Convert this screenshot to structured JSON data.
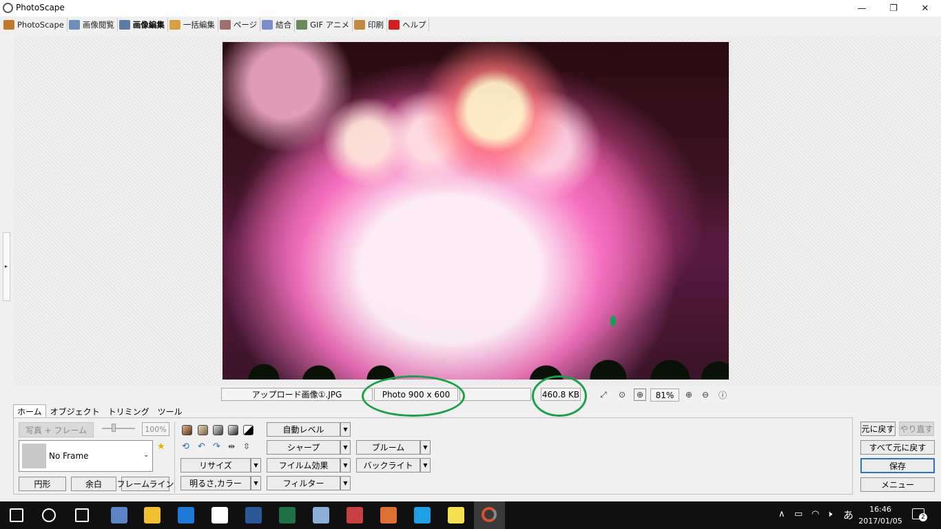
{
  "window": {
    "title": "PhotoScape",
    "controls": {
      "minimize": "—",
      "maximize": "❐",
      "close": "✕"
    }
  },
  "main_tabs": [
    {
      "label": "PhotoScape",
      "icon": "photoscape-icon",
      "color": "#c07a2a"
    },
    {
      "label": "画像閲覧",
      "icon": "viewer-icon",
      "color": "#6a8fb8"
    },
    {
      "label": "画像編集",
      "icon": "editor-icon",
      "color": "#5a7aa8",
      "active": true
    },
    {
      "label": "一括編集",
      "icon": "batch-icon",
      "color": "#d8a040"
    },
    {
      "label": "ページ",
      "icon": "page-icon",
      "color": "#a07070"
    },
    {
      "label": "結合",
      "icon": "combine-icon",
      "color": "#7a8fc8"
    },
    {
      "label": "GIF アニメ",
      "icon": "gif-icon",
      "color": "#6a8a5a"
    },
    {
      "label": "印刷",
      "icon": "print-icon",
      "color": "#c08a40"
    },
    {
      "label": "ヘルプ",
      "icon": "help-icon",
      "color": "#d02020"
    }
  ],
  "status": {
    "filename": "アップロード画像①.JPG",
    "dimensions": "Photo 900 x 600",
    "filesize": "460.8 KB",
    "zoom": "81%",
    "annotation_color": "#1aa04a"
  },
  "bottom_tabs": [
    "ホーム",
    "オブジェクト",
    "トリミング",
    "ツール"
  ],
  "home_panel": {
    "photo_frame_button": "写真 + フレーム",
    "opacity_value": "100%",
    "frame_select": "No Frame",
    "shape_buttons": [
      "円形",
      "余白",
      "フレームライン"
    ],
    "resize": "リサイズ",
    "brightness": "明るさ,カラー",
    "auto_level": "自動レベル",
    "sharpen": "シャープ",
    "film_effect": "フイルム効果",
    "filter": "フィルター",
    "bloom": "ブルーム",
    "backlight": "バックライト"
  },
  "right_actions": {
    "undo": "元に戻す",
    "redo": "やり直す",
    "undo_all": "すべて元に戻す",
    "save": "保存",
    "menu": "メニュー"
  },
  "taskbar": {
    "apps": [
      {
        "name": "windows-start-icon",
        "color": "#ffffff"
      },
      {
        "name": "cortana-icon",
        "color": "#ffffff"
      },
      {
        "name": "task-view-icon",
        "color": "#ffffff"
      },
      {
        "name": "photo-app-icon",
        "color": "#5a86c8"
      },
      {
        "name": "file-explorer-icon",
        "color": "#f0c030"
      },
      {
        "name": "edge-icon",
        "color": "#1e7ad8"
      },
      {
        "name": "store-icon",
        "color": "#ffffff"
      },
      {
        "name": "word-icon",
        "color": "#2b5797"
      },
      {
        "name": "excel-icon",
        "color": "#1e7145"
      },
      {
        "name": "paint-icon",
        "color": "#8ab0d8"
      },
      {
        "name": "tool-app-icon",
        "color": "#c84040"
      },
      {
        "name": "briefcase-icon",
        "color": "#e07030"
      },
      {
        "name": "ie-icon",
        "color": "#1ea0e8"
      },
      {
        "name": "sticky-notes-icon",
        "color": "#f5e050"
      },
      {
        "name": "photoscape-taskbar-icon",
        "color": "#e05030"
      }
    ],
    "ime": "あ",
    "time": "16:46",
    "date": "2017/01/05",
    "notifications": "2"
  }
}
